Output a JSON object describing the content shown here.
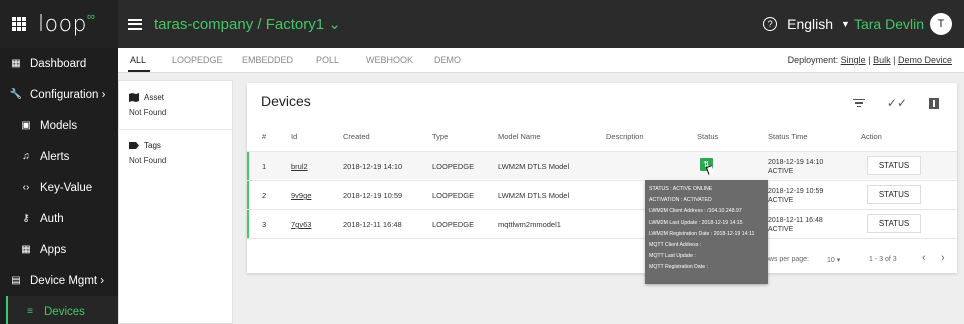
{
  "header": {
    "app_name": "loop",
    "app_name_mark": "∞",
    "breadcrumb": "taras-company / Factory1 ⌄",
    "language": "English",
    "user_name": "Tara Devlin",
    "avatar_initial": "T",
    "help_icon": "question-circle-icon",
    "accent_color": "#44c767"
  },
  "sidebar": {
    "items": [
      {
        "label": "Dashboard",
        "icon": "dashboard-icon"
      },
      {
        "label": "Configuration ›",
        "icon": "wrench-icon"
      },
      {
        "label": "Models",
        "icon": "models-icon"
      },
      {
        "label": "Alerts",
        "icon": "bell-icon"
      },
      {
        "label": "Key-Value",
        "icon": "code-icon"
      },
      {
        "label": "Auth",
        "icon": "key-icon"
      },
      {
        "label": "Apps",
        "icon": "apps-grid-icon"
      },
      {
        "label": "Device Mgmt ›",
        "icon": "device-mgmt-icon"
      },
      {
        "label": "Devices",
        "icon": "list-icon"
      }
    ]
  },
  "tabs": {
    "items": [
      "ALL",
      "LOOPEDGE",
      "EMBEDDED",
      "POLL",
      "WEBHOOK",
      "DEMO"
    ],
    "active": "ALL"
  },
  "deployment": {
    "label": "Deployment:",
    "single": "Single",
    "bulk": "Bulk",
    "demo": "Demo Device",
    "sep": "|"
  },
  "filters": {
    "asset_title": "Asset",
    "asset_value": "Not Found",
    "tags_title": "Tags",
    "tags_value": "Not Found"
  },
  "devices": {
    "title": "Devices",
    "columns": [
      "#",
      "Id",
      "Created",
      "Type",
      "Model Name",
      "Description",
      "Status",
      "Status Time",
      "Action"
    ],
    "rows": [
      {
        "num": "1",
        "id": "brul2",
        "created": "2018-12-19 14:10",
        "type": "LOOPEDGE",
        "model": "LWM2M DTLS Model",
        "description": "",
        "status_time": "2018-12-19 14:10",
        "status_state": "ACTIVE",
        "action": "STATUS"
      },
      {
        "num": "2",
        "id": "9v9ge",
        "created": "2018-12-19 10:59",
        "type": "LOOPEDGE",
        "model": "LWM2M DTLS Model",
        "description": "",
        "status_time": "2018-12-19 10:59",
        "status_state": "ACTIVE",
        "action": "STATUS"
      },
      {
        "num": "3",
        "id": "7gv63",
        "created": "2018-12-11 16:48",
        "type": "LOOPEDGE",
        "model": "mqttlwm2mmodel1",
        "description": "",
        "status_time": "2018-12-11 16:48",
        "status_state": "ACTIVE",
        "action": "STATUS"
      }
    ],
    "pager": {
      "rows_per_page_label": "ows per page:",
      "rows_per_page_value": "10 ▾",
      "range": "1 - 3 of 3",
      "prev": "‹",
      "next": "›"
    }
  },
  "tooltip": {
    "lines": [
      "STATUS : ACTIVE ONLINE",
      "ACTIVATION : ACTIVATED",
      "LWM2M Client Address : /104.10.248.97",
      "LWM2M Last Update : 2018-12-19 14:15",
      "LWM2M Registration Date : 2018-12-19 14:11",
      "MQTT Client Address :",
      "MQTT Last Update :",
      "MQTT Registration Date :"
    ]
  }
}
